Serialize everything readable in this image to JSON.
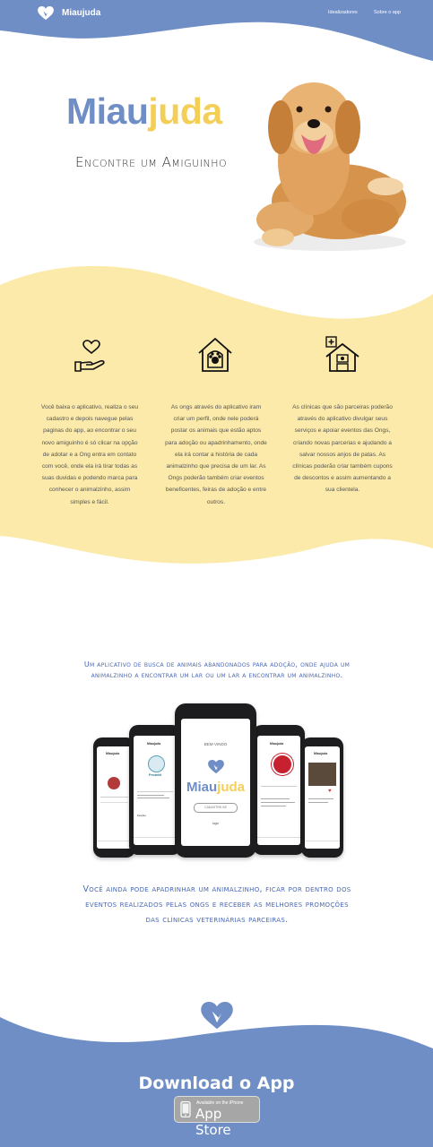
{
  "header": {
    "brand": "Miaujuda",
    "nav": [
      "Idealizadores",
      "Sobre o app"
    ]
  },
  "hero": {
    "title_part1": "Miau",
    "title_part2": "juda",
    "subtitle": "Encontre um Amiguinho"
  },
  "features": [
    {
      "icon": "heart-hand-icon",
      "text": "Você baixa o aplicativo, realiza o seu cadastro e depois navegue pelas paginas do app, ao encontrar o seu novo amiguinho é só clicar na opção de adotar e a Ong entra em contato com você, onde ela irá tirar todas as suas duvidas e podendo marca para conhecer o animalzinho, assim simples e fácil."
    },
    {
      "icon": "pet-house-icon",
      "text": "As ongs através do aplicativo iram criar um perfil, onde nele poderá postar os animais que estão aptos para adoção ou apadrinhamento, onde ela irá contar a história de cada animalzinho que precisa de um lar. As Ongs poderão também criar eventos beneficentes, feiras de adoção e entre outros."
    },
    {
      "icon": "clinic-icon",
      "text": "As clínicas que são parceiras poderão através do aplicativo divulgar seus serviços e apoiar eventos das Ongs, criando novas parcerias e ajudando a salvar nossos anjos de patas. As clínicas poderão criar também cupons de descontos e assim aumentando a sua clientela."
    }
  ],
  "tagline_1": "Um aplicativo de busca de animais abandonados para adoção, onde ajuda um animalzinho a encontrar um lar ou um lar a encontrar um animalzinho.",
  "phone_center": {
    "welcome": "BEM-VINDO",
    "brand_part1": "Miau",
    "brand_part2": "juda",
    "register": "CADASTRE-SE",
    "login": "login"
  },
  "phones_side": {
    "title": "Miaujuda",
    "ong_name": "Protetti",
    "donate_label": "Doações"
  },
  "tagline_2": "Você ainda pode apadrinhar um animalzinho, ficar por dentro dos eventos realizados pelas ongs e receber as melhores promoções das clínicas veterinárias parceiras.",
  "footer": {
    "download_title": "Download o App",
    "badge_small": "Available on the iPhone",
    "badge_big": "App Store"
  },
  "colors": {
    "blue": "#6e8ec5",
    "yellow": "#fbeaa9",
    "brand_yellow": "#f4cf57",
    "text_blue": "#4a68b6"
  }
}
